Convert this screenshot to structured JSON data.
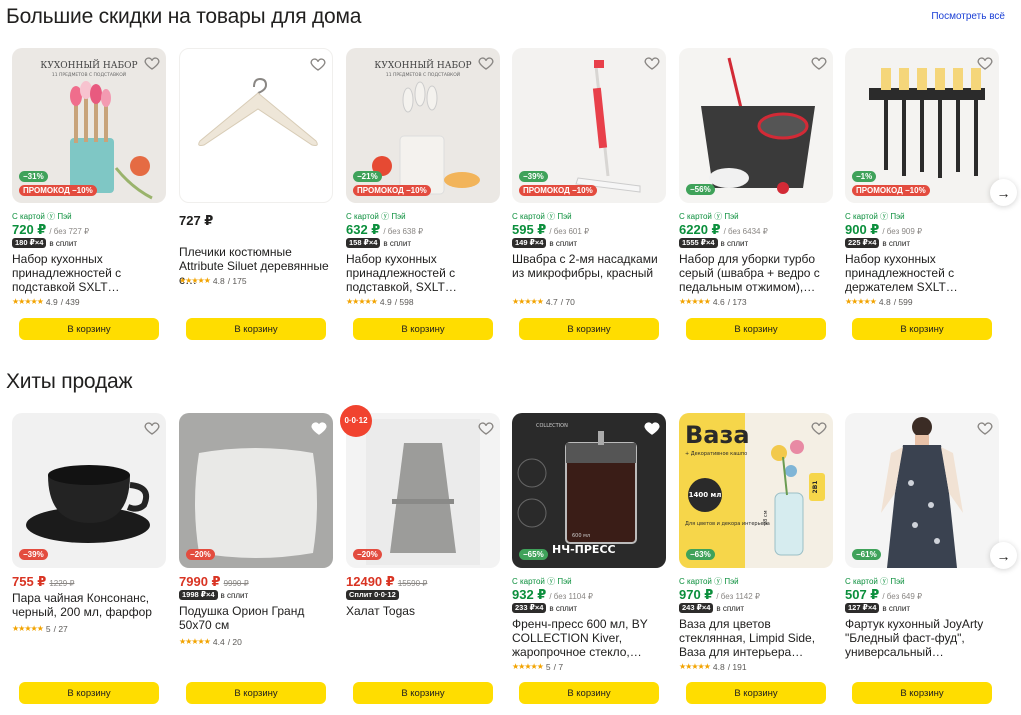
{
  "colors": {
    "accent_yellow": "#ffdd00",
    "price_green": "#0b8f3c",
    "discount_red": "#d93423",
    "link_blue": "#1a3fd6"
  },
  "section1": {
    "title": "Большие скидки на товары для дома",
    "see_all": "Посмотреть всё",
    "cards": [
      {
        "discount": "−31%",
        "promo": "ПРОМОКОД −10%",
        "pay": "С картой ⓨ Пэй",
        "price": "720 ₽",
        "old": "/ без 727 ₽",
        "split": "180 ₽×4",
        "split_text": "в сплит",
        "name": "Набор кухонных принадлежностей с подставкой SXLT…",
        "rating": "4.9",
        "reviews": "/ 439",
        "buy": "В корзину",
        "overlay": "КУХОННЫЙ НАБОР",
        "overlay_sub": "11 ПРЕДМЕТОВ С ПОДСТАВКОЙ"
      },
      {
        "price": "727 ₽",
        "name": "Плечики костюмные Attribute Siluet деревянные с…",
        "rating": "4.8",
        "reviews": "/ 175",
        "buy": "В корзину"
      },
      {
        "discount": "−21%",
        "promo": "ПРОМОКОД −10%",
        "pay": "С картой ⓨ Пэй",
        "price": "632 ₽",
        "old": "/ без 638 ₽",
        "split": "158 ₽×4",
        "split_text": "в сплит",
        "name": "Набор кухонных принадлежностей с подставкой, SXLT…",
        "rating": "4.9",
        "reviews": "/ 598",
        "buy": "В корзину",
        "overlay": "КУХОННЫЙ НАБОР",
        "overlay_sub": "11 ПРЕДМЕТОВ С ПОДСТАВКОЙ"
      },
      {
        "discount": "−39%",
        "promo": "ПРОМОКОД −10%",
        "pay": "С картой ⓨ Пэй",
        "price": "595 ₽",
        "old": "/ без 601 ₽",
        "split": "149 ₽×4",
        "split_text": "в сплит",
        "name": "Швабра с 2-мя насадками из микрофибры, красный",
        "rating": "4.7",
        "reviews": "/ 70",
        "buy": "В корзину"
      },
      {
        "discount": "−56%",
        "pay": "С картой ⓨ Пэй",
        "price": "6220 ₽",
        "old": "/ без 6434 ₽",
        "split": "1555 ₽×4",
        "split_text": "в сплит",
        "name": "Набор для уборки турбо серый (швабра + ведро с педальным отжимом),…",
        "rating": "4.6",
        "reviews": "/ 173",
        "buy": "В корзину"
      },
      {
        "discount": "−1%",
        "promo": "ПРОМОКОД −10%",
        "pay": "С картой ⓨ Пэй",
        "price": "900 ₽",
        "old": "/ без 909 ₽",
        "split": "225 ₽×4",
        "split_text": "в сплит",
        "name": "Набор кухонных принадлежностей с держателем SXLT…",
        "rating": "4.8",
        "reviews": "/ 599",
        "buy": "В корзину"
      }
    ]
  },
  "section2": {
    "title": "Хиты продаж",
    "cards": [
      {
        "discount": "−39%",
        "price": "755 ₽",
        "old": "1229 ₽",
        "name": "Пара чайная Консонанс, черный, 200 мл, фарфор",
        "rating": "5",
        "reviews": "/ 27",
        "buy": "В корзину"
      },
      {
        "discount": "−20%",
        "price": "7990 ₽",
        "old": "9990 ₽",
        "split": "1998 ₽×4",
        "split_text": "в сплит",
        "name": "Подушка Орион Гранд 50x70 см",
        "rating": "4.4",
        "reviews": "/ 20",
        "buy": "В корзину"
      },
      {
        "discount": "−20%",
        "price": "12490 ₽",
        "old": "15590 ₽",
        "split": "Сплит 0·0·12",
        "name": "Халат Togas",
        "buy": "В корзину",
        "tag": "0·0·12"
      },
      {
        "discount": "−65%",
        "pay": "С картой ⓨ Пэй",
        "price": "932 ₽",
        "old": "/ без 1104 ₽",
        "split": "233 ₽×4",
        "split_text": "в сплит",
        "name": "Френч-пресс 600 мл, BY COLLECTION Kiver, жаропрочное стекло,…",
        "rating": "5",
        "reviews": "/ 7",
        "buy": "В корзину",
        "overlay": "НЧ-ПРЕСС",
        "overlay_sub": "COLLECTION",
        "vol": "600 мл"
      },
      {
        "discount": "−63%",
        "pay": "С картой ⓨ Пэй",
        "price": "970 ₽",
        "old": "/ без 1142 ₽",
        "split": "243 ₽×4",
        "split_text": "в сплит",
        "name": "Ваза для цветов стеклянная, Limpid Side, Ваза для интерьера…",
        "rating": "4.8",
        "reviews": "/ 191",
        "buy": "В корзину",
        "overlay": "Ваза",
        "overlay_sub": "+ Декоративное кашпо",
        "ml": "1400 мл",
        "desc": "Для цветов и декора интерьера",
        "cm": "28 см",
        "twoin1": "2В1"
      },
      {
        "discount": "−61%",
        "pay": "С картой ⓨ Пэй",
        "price": "507 ₽",
        "old": "/ без 649 ₽",
        "split": "127 ₽×4",
        "split_text": "в сплит",
        "name": "Фартук кухонный JoyArty \"Бледный фаст-фуд\", универсальный…",
        "buy": "В корзину"
      }
    ]
  }
}
